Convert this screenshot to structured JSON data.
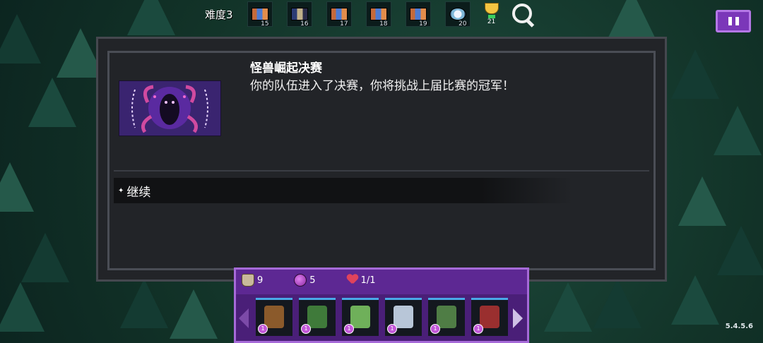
{
  "header": {
    "difficulty_label": "难度3",
    "stages": [
      {
        "num": "15"
      },
      {
        "num": "16"
      },
      {
        "num": "17"
      },
      {
        "num": "18"
      },
      {
        "num": "19"
      },
      {
        "num": "20"
      },
      {
        "num": "21"
      }
    ]
  },
  "event": {
    "title": "怪兽崛起决赛",
    "description": "你的队伍进入了决赛，你将挑战上届比赛的冠军！",
    "choices": [
      {
        "label": "继续"
      }
    ]
  },
  "party": {
    "stats": {
      "gold": "9",
      "orbs": "5",
      "hearts": "1/1"
    },
    "units": [
      {
        "level": "1",
        "color": "#8b5a2b"
      },
      {
        "level": "1",
        "color": "#3f7a3a"
      },
      {
        "level": "1",
        "color": "#6fb05a"
      },
      {
        "level": "1",
        "color": "#b8c6d8"
      },
      {
        "level": "1",
        "color": "#4f7d45"
      },
      {
        "level": "1",
        "color": "#9a2f2f"
      }
    ]
  },
  "footer": {
    "version": "5.4.5.6"
  },
  "colors": {
    "accent_purple": "#7b37b9",
    "panel_dark": "#222428"
  }
}
